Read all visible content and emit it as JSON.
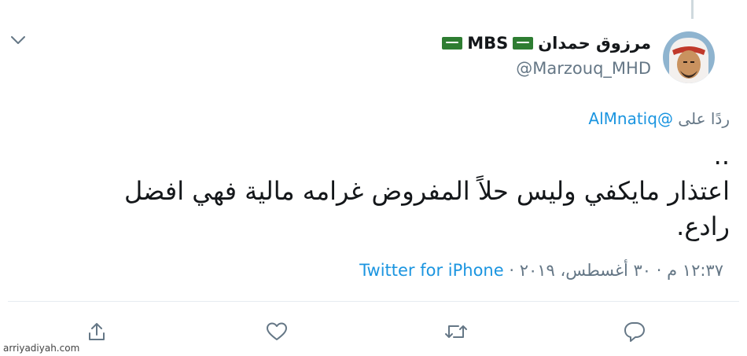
{
  "tweet": {
    "author_name": "مرزوق حمدان",
    "author_badge": "MBS",
    "handle": "@Marzouq_MHD",
    "reply_prefix": "ردًا على",
    "reply_handle": "@AlMnatiq",
    "text_lines": [
      "..",
      "اعتذار مايكفي وليس حلاً المفروض غرامه مالية  فهي افضل",
      "رادع."
    ],
    "timestamp": "١٢:٣٧ م · ٣٠ أغسطس، ٢٠١٩ ·",
    "source": "Twitter for iPhone"
  },
  "actions": {
    "share_icon": "share-icon",
    "like_icon": "heart-icon",
    "retweet_icon": "retweet-icon",
    "reply_icon": "reply-icon"
  },
  "watermark": "arriyadiyah.com",
  "colors": {
    "link": "#1b95e0",
    "muted": "#657786",
    "text": "#14171a",
    "flag_green": "#2e7d32"
  }
}
